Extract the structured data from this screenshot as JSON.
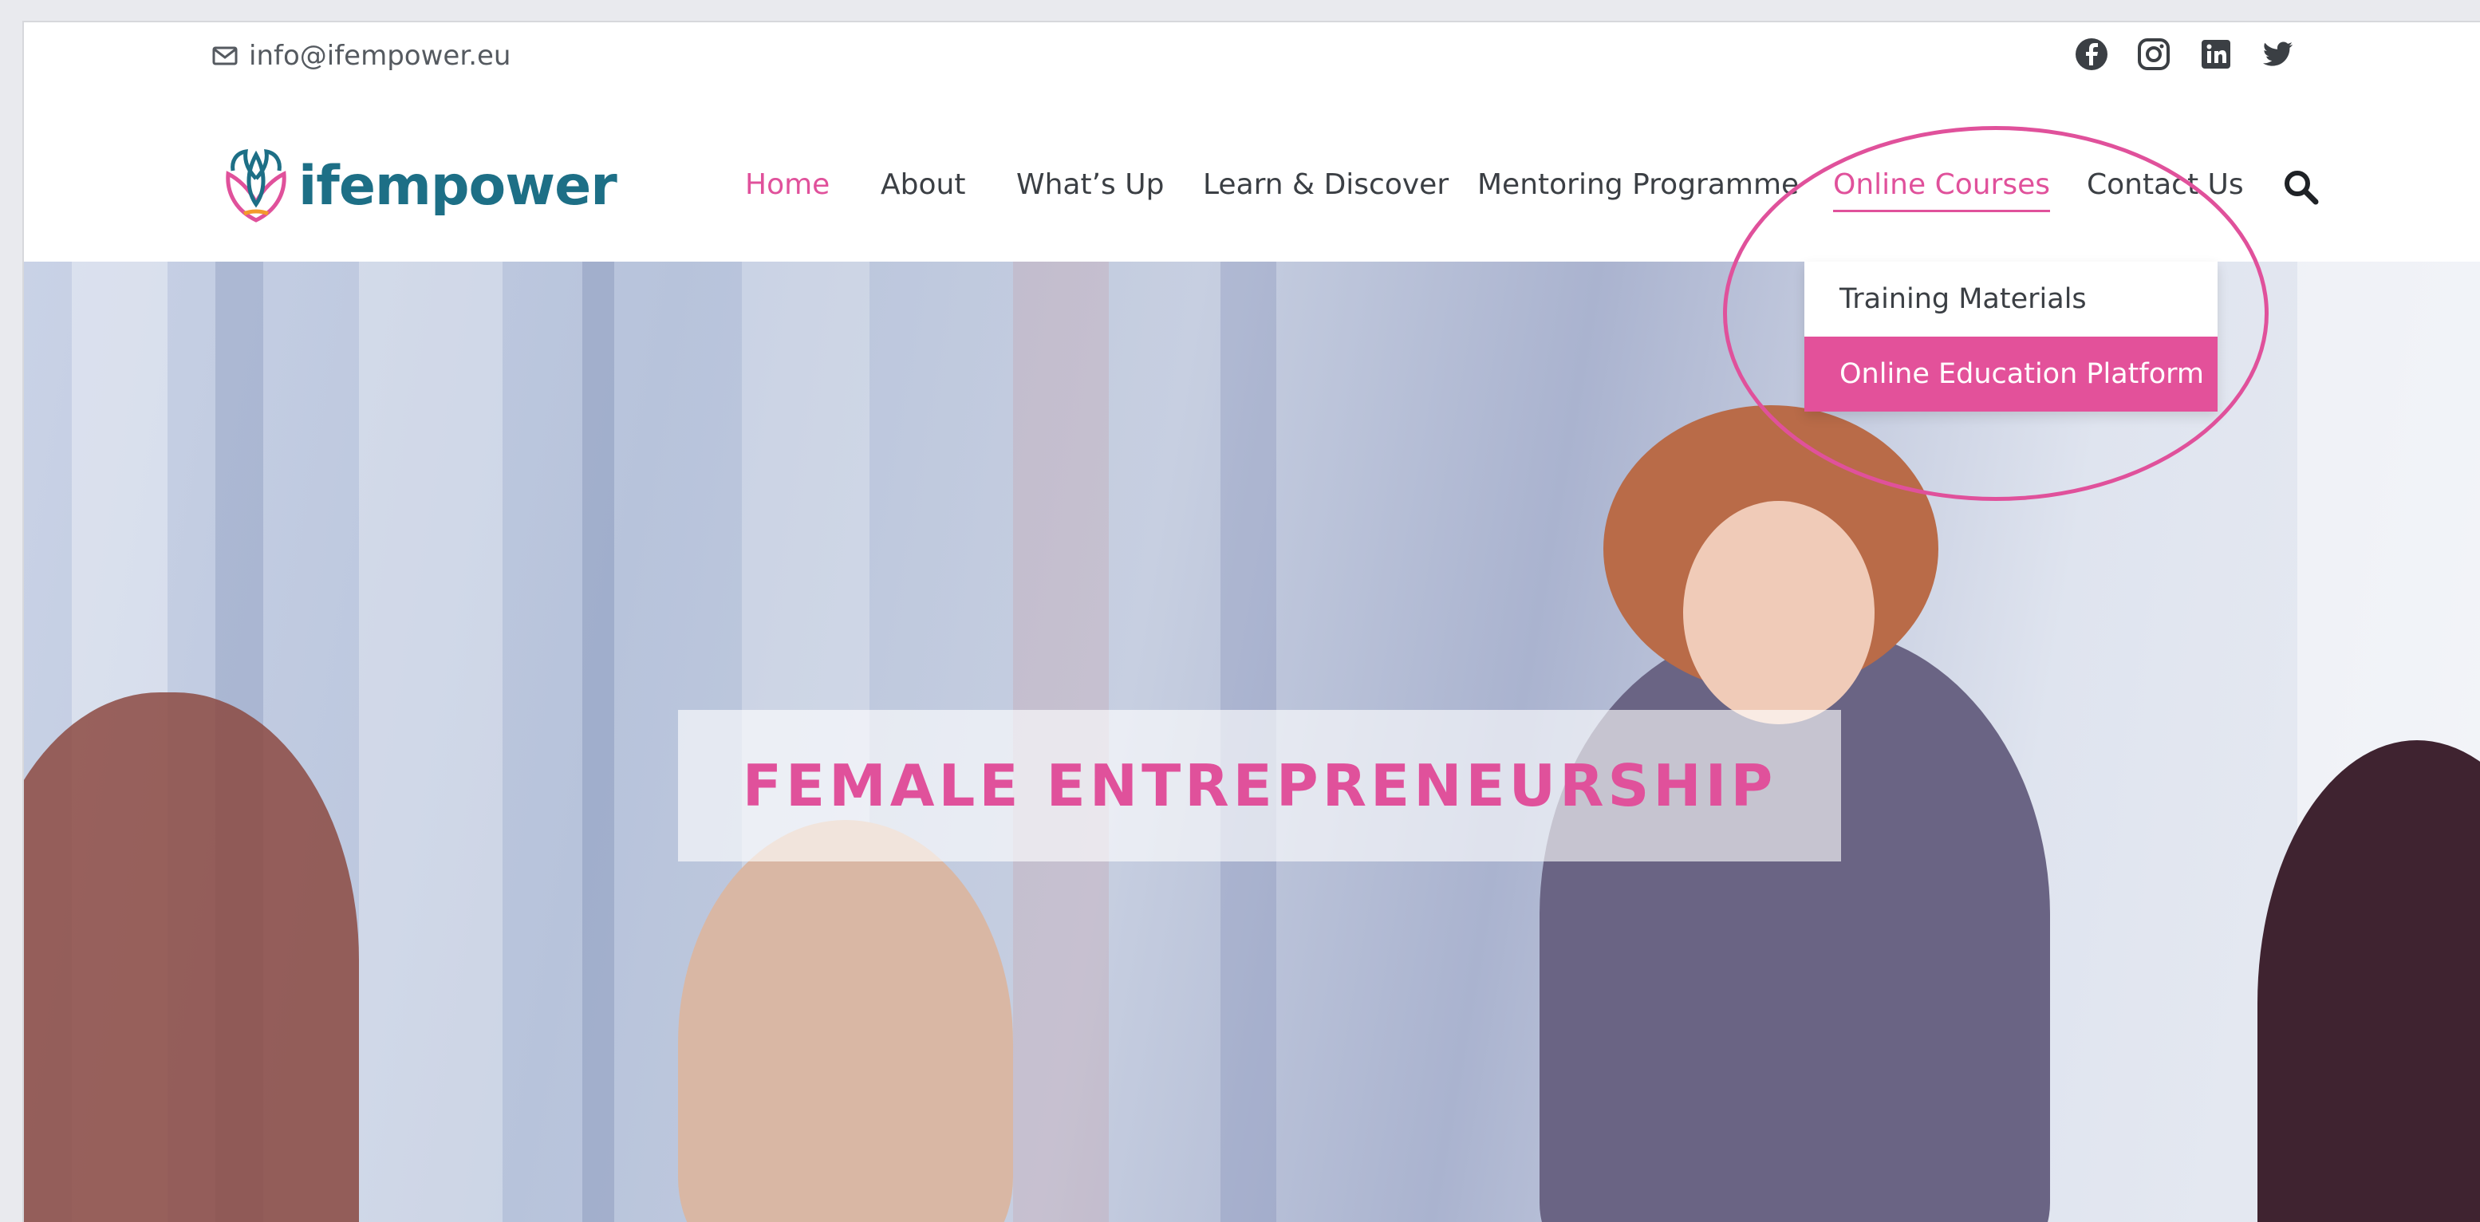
{
  "topbar": {
    "email": "info@ifempower.eu",
    "social_icons": [
      "facebook-icon",
      "instagram-icon",
      "linkedin-icon",
      "twitter-icon"
    ]
  },
  "logo": {
    "text": "ifempower"
  },
  "nav": {
    "items": [
      {
        "label": "Home",
        "state": "active"
      },
      {
        "label": "About"
      },
      {
        "label": "What’s Up"
      },
      {
        "label": "Learn & Discover"
      },
      {
        "label": "Mentoring Programme"
      },
      {
        "label": "Online Courses",
        "state": "open"
      },
      {
        "label": "Contact Us"
      }
    ],
    "search_icon": "search-icon"
  },
  "dropdown": {
    "items": [
      {
        "label": "Training Materials"
      },
      {
        "label": "Online Education Platform",
        "highlighted": true
      }
    ]
  },
  "hero": {
    "title": "FEMALE ENTREPRENEURSHIP"
  },
  "colors": {
    "accent": "#e0519b",
    "brand_teal": "#1d6f86",
    "text": "#3b3f44"
  }
}
